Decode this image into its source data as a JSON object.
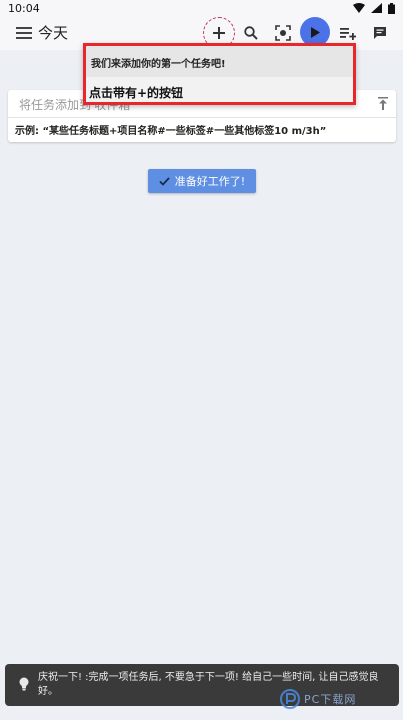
{
  "status_bar": {
    "time": "10:04"
  },
  "appbar": {
    "title": "今天"
  },
  "task_input": {
    "placeholder": "将任务添加到'收件箱'",
    "example": "示例: “某些任务标题+项目名称#一些标签#一些其他标签10 m/3h”"
  },
  "ready_button": {
    "label": "准备好工作了!"
  },
  "tip_popup": {
    "line1": "我们来添加你的第一个任务吧!",
    "line2": "点击带有+的按钮"
  },
  "snackbar": {
    "text": "庆祝一下! :完成一项任务后, 不要急于下一项! 给自己一些时间, 让自己感觉良好。"
  },
  "watermark": {
    "text": "PC下载网"
  },
  "colors": {
    "accent": "#4b72e8",
    "highlight_border": "#e8272d",
    "add_button_ring": "#c0325c",
    "ready_button": "#5e8fe3",
    "snackbar": "#3a3a3a"
  },
  "icons": {
    "menu": "hamburger-icon",
    "add": "plus-icon",
    "search": "search-icon",
    "focus": "target-icon",
    "play": "play-icon",
    "add_list": "playlist-add-icon",
    "comment": "comment-icon",
    "pin": "pin-top-icon",
    "check": "check-icon",
    "bulb": "lightbulb-icon"
  }
}
